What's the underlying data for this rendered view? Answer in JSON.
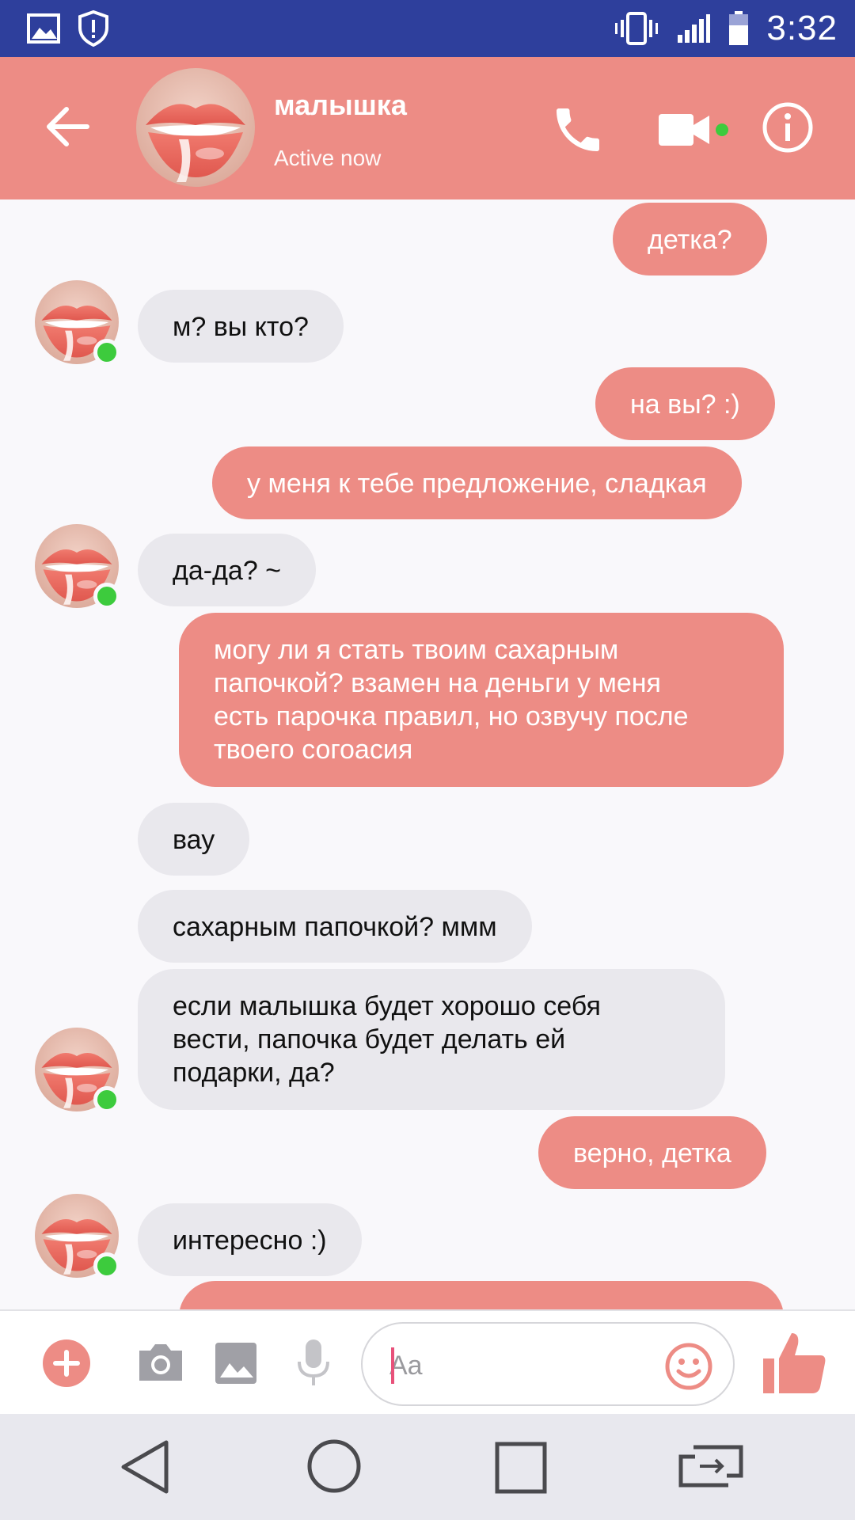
{
  "status_bar": {
    "time": "3:32",
    "icons": [
      "image-icon",
      "shield-alert-icon",
      "vibrate-icon",
      "signal-icon",
      "battery-icon"
    ]
  },
  "header": {
    "contact_name": "малышка",
    "contact_status": "Active now",
    "icons": [
      "back-arrow-icon",
      "phone-icon",
      "video-camera-icon",
      "info-icon"
    ]
  },
  "messages": [
    {
      "from": "me",
      "text": "детка?"
    },
    {
      "from": "them",
      "text": "м? вы кто?"
    },
    {
      "from": "me",
      "text": "на вы? :)"
    },
    {
      "from": "me",
      "text": "у меня к тебе предложение, сладкая"
    },
    {
      "from": "them",
      "text": "да-да? ~"
    },
    {
      "from": "me",
      "text": "могу ли я стать твоим сахарным\nпапочкой? взамен на деньги у меня\nесть парочка правил, но озвучу после\nтвоего согоасия"
    },
    {
      "from": "them",
      "text": "вау"
    },
    {
      "from": "them",
      "text": "сахарным папочкой? ммм"
    },
    {
      "from": "them",
      "text": " если малышка будет хорошо себя\nвести, папочка будет делать ей\nподарки, да?"
    },
    {
      "from": "me",
      "text": "верно, детка"
    },
    {
      "from": "them",
      "text": "интересно :)"
    }
  ],
  "input": {
    "placeholder": "Aa",
    "icons": [
      "add-icon",
      "camera-icon",
      "gallery-icon",
      "microphone-icon",
      "emoji-icon",
      "thumbs-up-icon"
    ]
  },
  "colors": {
    "status_bar": "#2e3f9c",
    "accent": "#ed8c85",
    "received_bubble": "#e9e8ed",
    "online": "#3dcb3d"
  },
  "nav": {
    "icons": [
      "nav-back-icon",
      "nav-home-icon",
      "nav-recents-icon",
      "nav-switch-icon"
    ]
  }
}
